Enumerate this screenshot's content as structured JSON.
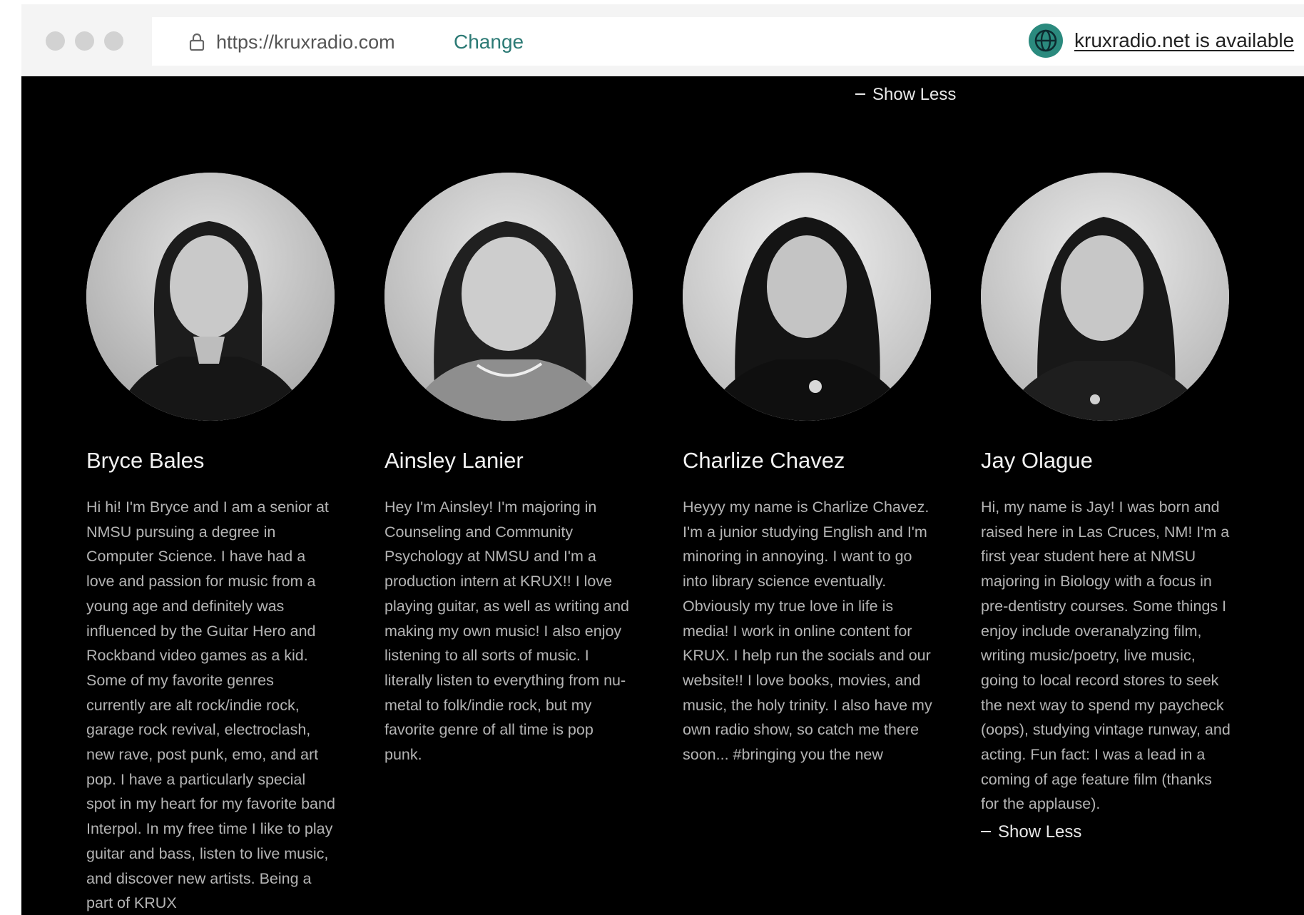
{
  "browser": {
    "url": "https://kruxradio.com",
    "change_label": "Change",
    "availability_text": "kruxradio.net is available"
  },
  "show_less_label": "Show Less",
  "colors": {
    "background": "#000000",
    "toolbar": "#f4f4f4",
    "accent": "#2c7a75",
    "bio_text": "#b4b4b4",
    "name_text": "#f2f2f2"
  },
  "staff": [
    {
      "name": "Bryce Bales",
      "bio": "Hi hi! I'm Bryce and I am a senior at NMSU pursuing a degree in Computer Science. I have had a love and passion for music from a young age and definitely was influenced by the Guitar Hero and Rockband video games as a kid. Some of my favorite genres currently are alt rock/indie rock, garage rock revival, electroclash, new rave, post punk, emo, and art pop. I have a particularly special spot in my heart for my favorite band Interpol. In my free time I like to play guitar and bass, listen to live music, and discover new artists. Being a part of KRUX"
    },
    {
      "name": "Ainsley Lanier",
      "bio": "Hey I'm Ainsley! I'm majoring in Counseling and Community Psychology at NMSU and I'm a production intern at KRUX!! I love playing guitar, as well as writing and making my own music! I also enjoy listening to all sorts of music. I literally listen to everything from nu-metal to folk/indie rock, but my favorite genre of all time is pop punk."
    },
    {
      "name": "Charlize Chavez",
      "bio": "Heyyy my name is Charlize Chavez. I'm a junior studying English and I'm minoring in annoying. I want to go into library science eventually. Obviously my true love in life is media! I work in online content for KRUX. I help run the socials and our website!! I love books, movies, and music, the holy trinity. I also have my own radio show, so catch me there soon... #bringing you the new"
    },
    {
      "name": "Jay Olague",
      "bio": "Hi, my name is Jay! I was born and raised here in Las Cruces, NM! I'm a first year student here at NMSU majoring in Biology with a focus in pre-dentistry courses. Some things I enjoy include overanalyzing film, writing music/poetry, live music, going to local record stores to seek the next way to spend my paycheck (oops), studying vintage runway, and acting. Fun fact: I was a lead in a coming of age feature film (thanks for the applause)."
    }
  ]
}
